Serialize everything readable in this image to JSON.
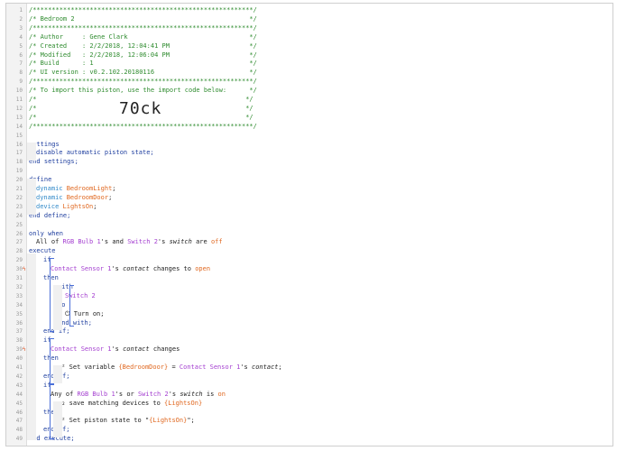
{
  "lines": [
    {
      "n": "1",
      "segs": [
        {
          "t": "/**********************************************************/",
          "c": "cm"
        }
      ]
    },
    {
      "n": "2",
      "segs": [
        {
          "t": "/* Bedroom 2                                              */",
          "c": "cm"
        }
      ]
    },
    {
      "n": "3",
      "segs": [
        {
          "t": "/**********************************************************/",
          "c": "cm"
        }
      ]
    },
    {
      "n": "4",
      "segs": [
        {
          "t": "/* Author     : Gene Clark                                */",
          "c": "cm"
        }
      ]
    },
    {
      "n": "5",
      "segs": [
        {
          "t": "/* Created    : 2/2/2018, 12:04:41 PM                     */",
          "c": "cm"
        }
      ]
    },
    {
      "n": "6",
      "segs": [
        {
          "t": "/* Modified   : 2/2/2018, 12:06:04 PM                     */",
          "c": "cm"
        }
      ]
    },
    {
      "n": "7",
      "segs": [
        {
          "t": "/* Build      : 1                                         */",
          "c": "cm"
        }
      ]
    },
    {
      "n": "8",
      "segs": [
        {
          "t": "/* UI version : v0.2.102.20180116                         */",
          "c": "cm"
        }
      ]
    },
    {
      "n": "9",
      "segs": [
        {
          "t": "/**********************************************************/",
          "c": "cm"
        }
      ]
    },
    {
      "n": "10",
      "segs": [
        {
          "t": "/* To import this piston, use the import code below:      */",
          "c": "cm"
        }
      ]
    },
    {
      "n": "11",
      "segs": [
        {
          "t": "/*                                                       */",
          "c": "cm"
        }
      ]
    },
    {
      "n": "12",
      "segs": [
        {
          "t": "/*                                                       */",
          "c": "cm"
        }
      ],
      "big": "70ck"
    },
    {
      "n": "13",
      "segs": [
        {
          "t": "/*                                                       */",
          "c": "cm"
        }
      ]
    },
    {
      "n": "14",
      "segs": [
        {
          "t": "/**********************************************************/",
          "c": "cm"
        }
      ]
    },
    {
      "n": "15",
      "segs": []
    },
    {
      "n": "16",
      "segs": [
        {
          "t": "settings",
          "c": "kw"
        }
      ]
    },
    {
      "n": "17",
      "indent": 1,
      "segs": [
        {
          "t": "disable automatic piston state;",
          "c": "kw"
        }
      ]
    },
    {
      "n": "18",
      "segs": [
        {
          "t": "end settings;",
          "c": "kw"
        }
      ]
    },
    {
      "n": "19",
      "segs": []
    },
    {
      "n": "20",
      "segs": [
        {
          "t": "define",
          "c": "kw"
        }
      ]
    },
    {
      "n": "21",
      "indent": 1,
      "segs": [
        {
          "t": "dynamic ",
          "c": "ty"
        },
        {
          "t": "BedroomLight",
          "c": "vr"
        },
        {
          "t": ";",
          "c": ""
        }
      ]
    },
    {
      "n": "22",
      "indent": 1,
      "segs": [
        {
          "t": "dynamic ",
          "c": "ty"
        },
        {
          "t": "BedroomDoor",
          "c": "vr"
        },
        {
          "t": ";",
          "c": ""
        }
      ]
    },
    {
      "n": "23",
      "indent": 1,
      "segs": [
        {
          "t": "device ",
          "c": "ty"
        },
        {
          "t": "LightsOn",
          "c": "vr"
        },
        {
          "t": ";",
          "c": ""
        }
      ]
    },
    {
      "n": "24",
      "segs": [
        {
          "t": "end define;",
          "c": "kw"
        }
      ]
    },
    {
      "n": "25",
      "segs": []
    },
    {
      "n": "26",
      "segs": [
        {
          "t": "only when",
          "c": "kw"
        }
      ]
    },
    {
      "n": "27",
      "indent": 1,
      "segs": [
        {
          "t": "All of ",
          "c": ""
        },
        {
          "t": "RGB Bulb 1",
          "c": "dv"
        },
        {
          "t": "'s and ",
          "c": ""
        },
        {
          "t": "Switch 2",
          "c": "dv"
        },
        {
          "t": "'s ",
          "c": ""
        },
        {
          "t": "switch",
          "c": "it"
        },
        {
          "t": " are ",
          "c": ""
        },
        {
          "t": "off",
          "c": "vr"
        }
      ]
    },
    {
      "n": "28",
      "segs": [
        {
          "t": "execute",
          "c": "kw"
        }
      ]
    },
    {
      "n": "29",
      "indent": 2,
      "segs": [
        {
          "t": "if",
          "c": "kw"
        }
      ]
    },
    {
      "n": "30",
      "indent": 3,
      "mark": "ϟ",
      "segs": [
        {
          "t": "Contact Sensor 1",
          "c": "dv"
        },
        {
          "t": "'s ",
          "c": ""
        },
        {
          "t": "contact",
          "c": "it"
        },
        {
          "t": " changes to ",
          "c": ""
        },
        {
          "t": "open",
          "c": "vr"
        }
      ]
    },
    {
      "n": "31",
      "indent": 2,
      "segs": [
        {
          "t": "then",
          "c": "kw"
        }
      ]
    },
    {
      "n": "32",
      "indent": 4,
      "segs": [
        {
          "t": "with",
          "c": "kw"
        }
      ]
    },
    {
      "n": "33",
      "indent": 5,
      "segs": [
        {
          "t": "Switch 2",
          "c": "dv"
        }
      ]
    },
    {
      "n": "34",
      "indent": 4,
      "segs": [
        {
          "t": "do",
          "c": "kw"
        }
      ]
    },
    {
      "n": "35",
      "indent": 5,
      "icon": "⏻",
      "segs": [
        {
          "t": "Turn on;",
          "c": ""
        }
      ]
    },
    {
      "n": "36",
      "indent": 4,
      "segs": [
        {
          "t": "end with;",
          "c": "kw"
        }
      ]
    },
    {
      "n": "37",
      "indent": 2,
      "segs": [
        {
          "t": "end if;",
          "c": "kw"
        }
      ]
    },
    {
      "n": "38",
      "indent": 2,
      "segs": [
        {
          "t": "if",
          "c": "kw"
        }
      ]
    },
    {
      "n": "39",
      "indent": 3,
      "mark": "ϟ",
      "segs": [
        {
          "t": "Contact Sensor 1",
          "c": "dv"
        },
        {
          "t": "'s ",
          "c": ""
        },
        {
          "t": "contact",
          "c": "it"
        },
        {
          "t": " changes",
          "c": ""
        }
      ]
    },
    {
      "n": "40",
      "indent": 2,
      "segs": [
        {
          "t": "then",
          "c": "kw"
        }
      ]
    },
    {
      "n": "41",
      "indent": 4,
      "icon": "x²",
      "segs": [
        {
          "t": "Set variable ",
          "c": ""
        },
        {
          "t": "{BedroomDoor}",
          "c": "vr"
        },
        {
          "t": " = ",
          "c": ""
        },
        {
          "t": "Contact Sensor 1",
          "c": "dv"
        },
        {
          "t": "'s ",
          "c": ""
        },
        {
          "t": "contact",
          "c": "it"
        },
        {
          "t": ";",
          "c": ""
        }
      ]
    },
    {
      "n": "42",
      "indent": 2,
      "segs": [
        {
          "t": "end if;",
          "c": "kw"
        }
      ]
    },
    {
      "n": "43",
      "indent": 2,
      "segs": [
        {
          "t": "if",
          "c": "kw"
        }
      ]
    },
    {
      "n": "44",
      "indent": 3,
      "segs": [
        {
          "t": "Any of ",
          "c": ""
        },
        {
          "t": "RGB Bulb 1",
          "c": "dv"
        },
        {
          "t": "'s or ",
          "c": ""
        },
        {
          "t": "Switch 2",
          "c": "dv"
        },
        {
          "t": "'s ",
          "c": ""
        },
        {
          "t": "switch",
          "c": "it"
        },
        {
          "t": " is ",
          "c": ""
        },
        {
          "t": "on",
          "c": "vr"
        }
      ]
    },
    {
      "n": "45",
      "indent": 4,
      "icon": "x₂",
      "segs": [
        {
          "t": "save matching devices to ",
          "c": ""
        },
        {
          "t": "{LightsOn}",
          "c": "vr"
        }
      ]
    },
    {
      "n": "46",
      "indent": 2,
      "segs": [
        {
          "t": "then",
          "c": "kw"
        }
      ]
    },
    {
      "n": "47",
      "indent": 4,
      "icon": "x²",
      "segs": [
        {
          "t": "Set piston state to \"",
          "c": ""
        },
        {
          "t": "{LightsOn}",
          "c": "vr"
        },
        {
          "t": "\";",
          "c": ""
        }
      ]
    },
    {
      "n": "48",
      "indent": 2,
      "segs": [
        {
          "t": "end if;",
          "c": "kw"
        }
      ]
    },
    {
      "n": "49",
      "segs": [
        {
          "t": "end execute;",
          "c": "kw"
        }
      ]
    }
  ]
}
